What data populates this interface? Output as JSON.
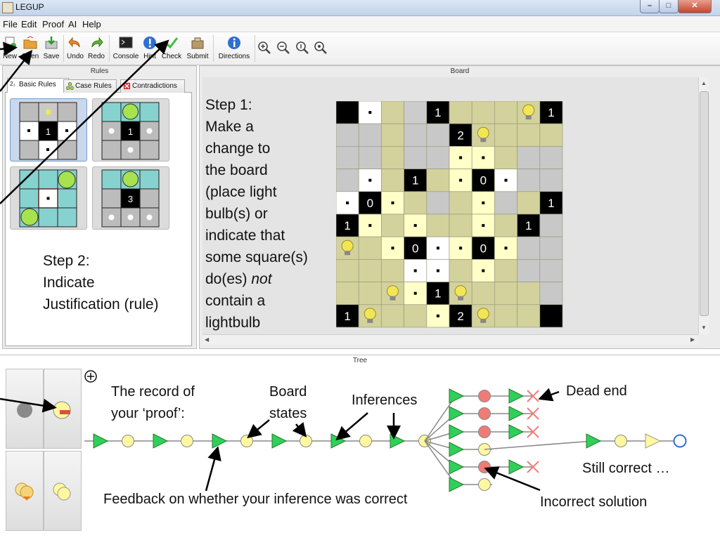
{
  "window": {
    "title": "LEGUP"
  },
  "menu": [
    "File",
    "Edit",
    "Proof",
    "AI",
    "Help"
  ],
  "toolbar": [
    {
      "label": "New",
      "icon": "new-file-icon"
    },
    {
      "label": "Open",
      "icon": "open-folder-icon"
    },
    {
      "label": "Save",
      "icon": "save-icon"
    },
    {
      "label": "Undo",
      "icon": "undo-icon"
    },
    {
      "label": "Redo",
      "icon": "redo-icon"
    },
    {
      "label": "Console",
      "icon": "console-icon"
    },
    {
      "label": "Hint",
      "icon": "hint-icon"
    },
    {
      "label": "Check",
      "icon": "check-icon"
    },
    {
      "label": "Submit",
      "icon": "submit-icon"
    },
    {
      "label": "Directions",
      "icon": "directions-icon"
    }
  ],
  "zoom_icons": [
    "zoom-in-icon",
    "zoom-out-icon",
    "zoom-fit-icon",
    "zoom-reset-icon"
  ],
  "rules_panel": {
    "title": "Rules",
    "tabs": [
      "Basic Rules",
      "Case Rules",
      "Contradictions"
    ],
    "tab_prefix": "2₃",
    "rule_numbers": [
      "1",
      "1",
      "3"
    ]
  },
  "board_panel": {
    "title": "Board"
  },
  "tree_panel": {
    "title": "Tree"
  },
  "board": {
    "rows": [
      "K W Y . K Y Y Y L K",
      "G G Y G G K L Y Y Y",
      "G G Y G G D D Y G G",
      "G W Y K Y D K W G G",
      "W K D Y G Y D G Y K",
      "K D Y D Y Y D Y K G",
      "L Y D K W D K D G G",
      "Y Y Y W W Y D Y G G",
      "Y Y L D K L Y Y Y G",
      "K L Y Y D K L Y Y K"
    ],
    "numbers": [
      [
        0,
        0,
        ""
      ],
      [
        0,
        4,
        "1"
      ],
      [
        0,
        9,
        "1"
      ],
      [
        1,
        5,
        "2"
      ],
      [
        3,
        3,
        "1"
      ],
      [
        3,
        6,
        "0"
      ],
      [
        4,
        1,
        "0"
      ],
      [
        4,
        9,
        "1"
      ],
      [
        5,
        0,
        "1"
      ],
      [
        5,
        8,
        "1"
      ],
      [
        6,
        3,
        "0"
      ],
      [
        6,
        6,
        "0"
      ],
      [
        8,
        4,
        "1"
      ],
      [
        9,
        0,
        "1"
      ],
      [
        9,
        5,
        "2"
      ],
      [
        9,
        9,
        ""
      ]
    ]
  },
  "annotations": {
    "step1": [
      "Step 1:",
      "Make a",
      "change to",
      "the board",
      "(place light",
      "bulb(s) or",
      "indicate that",
      "some square(s)"
    ],
    "step1_do": "do(es) ",
    "step1_not": "not",
    "step1_end": [
      "contain a",
      "lightbulb"
    ],
    "step2": [
      "Step 2:",
      "Indicate",
      "Justification (rule)"
    ],
    "record": [
      "The record of",
      "your ‘proof’:"
    ],
    "board_states": [
      "Board",
      "states"
    ],
    "inferences": "Inferences",
    "dead_end": "Dead end",
    "still_correct": "Still correct …",
    "feedback": "Feedback on whether your inference was correct",
    "incorrect": "Incorrect solution"
  },
  "colors": {
    "accent_blue": "#2f6fd0",
    "bulb_yellow": "#f3e655",
    "lit_cell": "#ffffc8",
    "board_tan": "#d3d29c",
    "tree_green": "#2fd05a",
    "tree_red": "#f07b76",
    "node_yellow": "#fff8a0"
  }
}
